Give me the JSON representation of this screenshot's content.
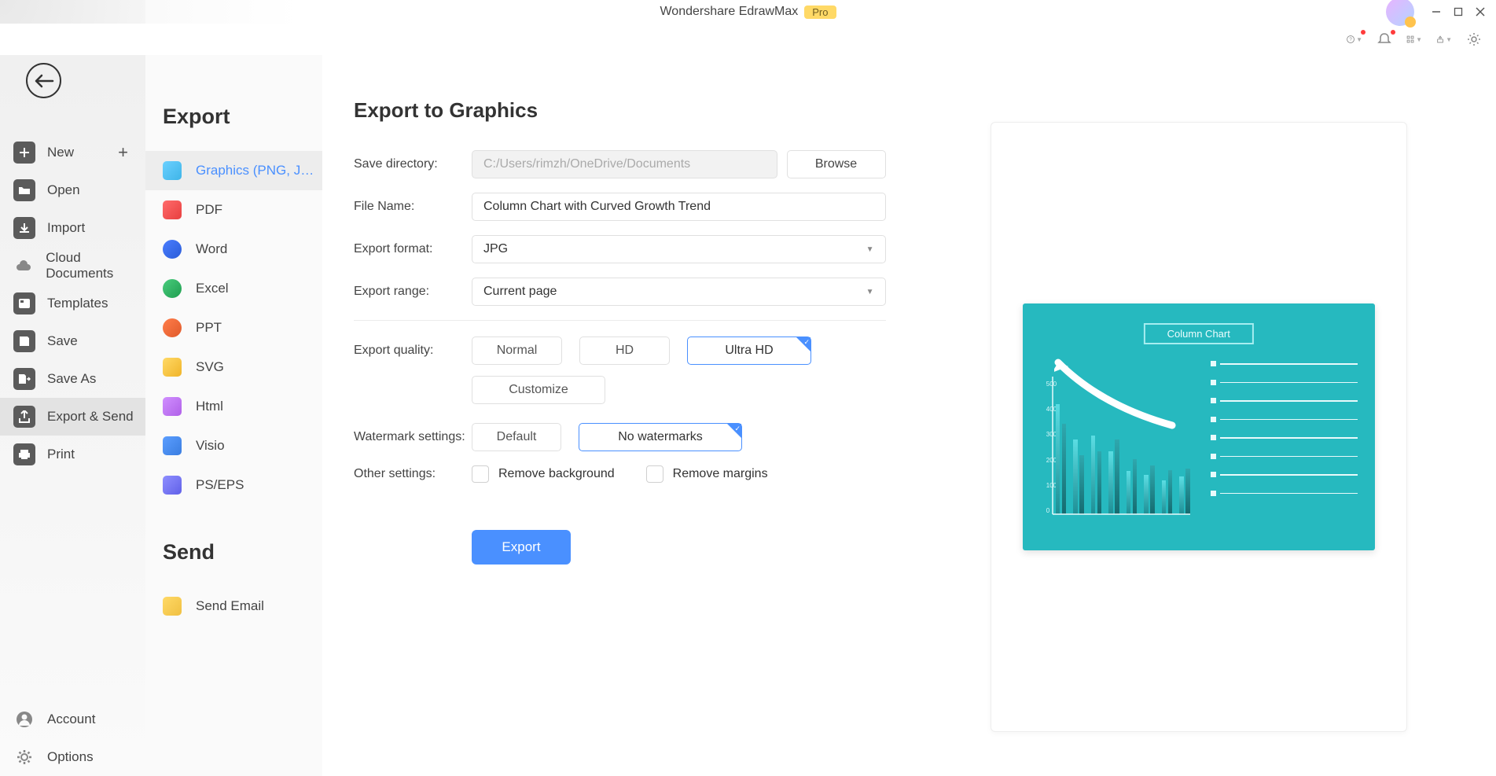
{
  "app": {
    "title": "Wondershare EdrawMax",
    "pro_badge": "Pro"
  },
  "sidebar_main": {
    "items": [
      {
        "label": "New",
        "icon": "plus-icon",
        "has_add": true
      },
      {
        "label": "Open",
        "icon": "folder-icon"
      },
      {
        "label": "Import",
        "icon": "download-icon"
      },
      {
        "label": "Cloud Documents",
        "icon": "cloud-icon"
      },
      {
        "label": "Templates",
        "icon": "templates-icon"
      },
      {
        "label": "Save",
        "icon": "save-icon"
      },
      {
        "label": "Save As",
        "icon": "save-as-icon"
      },
      {
        "label": "Export & Send",
        "icon": "export-icon",
        "active": true
      },
      {
        "label": "Print",
        "icon": "print-icon"
      }
    ],
    "footer": [
      {
        "label": "Account",
        "icon": "account-icon"
      },
      {
        "label": "Options",
        "icon": "options-icon"
      }
    ]
  },
  "sidebar_sub": {
    "export_heading": "Export",
    "send_heading": "Send",
    "export_items": [
      {
        "label": "Graphics (PNG, JPG et...",
        "icon_class": "graphics",
        "active": true
      },
      {
        "label": "PDF",
        "icon_class": "pdf"
      },
      {
        "label": "Word",
        "icon_class": "word"
      },
      {
        "label": "Excel",
        "icon_class": "excel"
      },
      {
        "label": "PPT",
        "icon_class": "ppt"
      },
      {
        "label": "SVG",
        "icon_class": "svg"
      },
      {
        "label": "Html",
        "icon_class": "html"
      },
      {
        "label": "Visio",
        "icon_class": "visio"
      },
      {
        "label": "PS/EPS",
        "icon_class": "pseps"
      }
    ],
    "send_items": [
      {
        "label": "Send Email",
        "icon_class": "email"
      }
    ]
  },
  "form": {
    "title": "Export to Graphics",
    "save_directory_label": "Save directory:",
    "save_directory_value": "C:/Users/rimzh/OneDrive/Documents",
    "browse_button": "Browse",
    "file_name_label": "File Name:",
    "file_name_value": "Column Chart with Curved Growth Trend",
    "export_format_label": "Export format:",
    "export_format_value": "JPG",
    "export_range_label": "Export range:",
    "export_range_value": "Current page",
    "export_quality_label": "Export quality:",
    "quality_normal": "Normal",
    "quality_hd": "HD",
    "quality_ultrahd": "Ultra HD",
    "customize_button": "Customize",
    "watermark_label": "Watermark settings:",
    "watermark_default": "Default",
    "watermark_none": "No watermarks",
    "other_settings_label": "Other settings:",
    "remove_background": "Remove background",
    "remove_margins": "Remove margins",
    "export_button": "Export"
  },
  "preview": {
    "chart_title": "Column Chart"
  }
}
